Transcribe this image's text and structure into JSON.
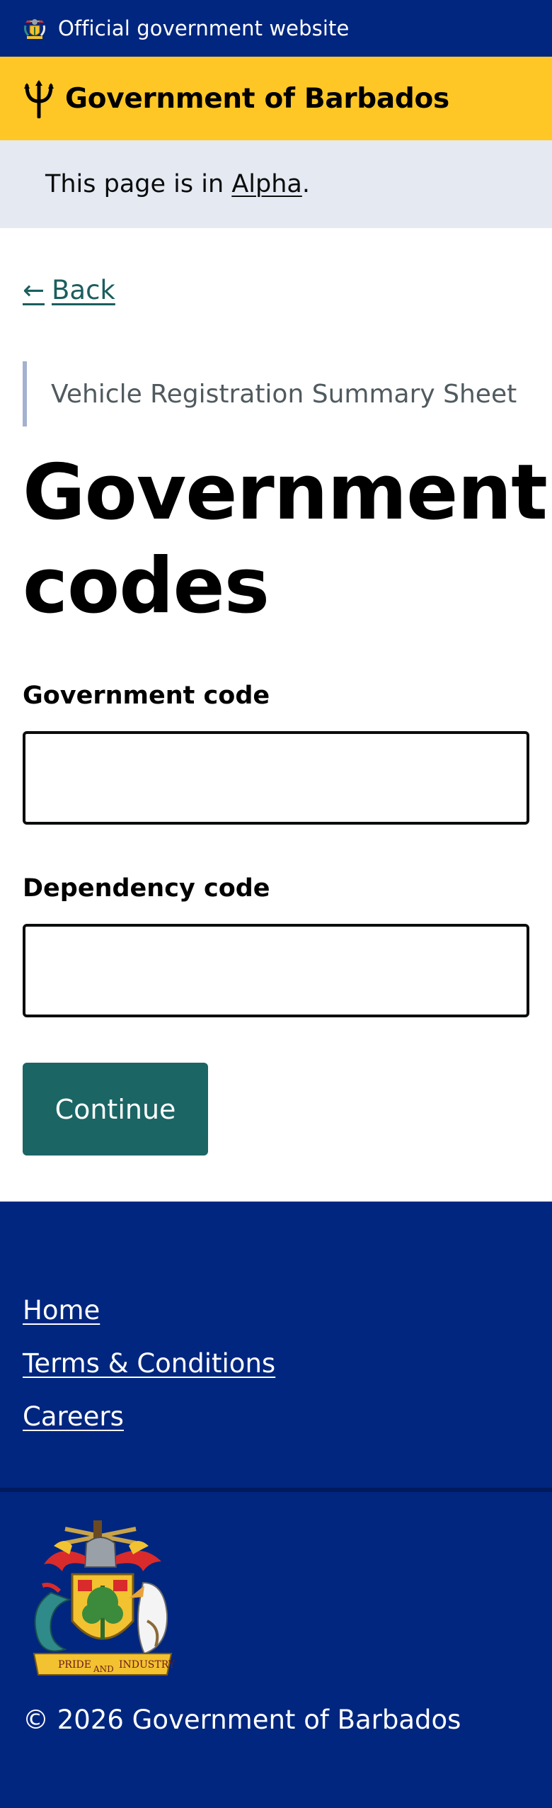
{
  "official_banner": {
    "text": "Official government website"
  },
  "header": {
    "brand": "Government of Barbados"
  },
  "phase_banner": {
    "prefix": "This page is in ",
    "link": "Alpha",
    "suffix": "."
  },
  "back_link": {
    "arrow": "←",
    "label": "Back"
  },
  "caption": "Vehicle Registration Summary Sheet",
  "heading": "Government codes",
  "form": {
    "government_code": {
      "label": "Government code",
      "value": "",
      "placeholder": ""
    },
    "dependency_code": {
      "label": "Dependency code",
      "value": "",
      "placeholder": ""
    },
    "continue_label": "Continue"
  },
  "footer": {
    "links": [
      {
        "label": "Home"
      },
      {
        "label": "Terms & Conditions"
      },
      {
        "label": "Careers"
      }
    ],
    "copyright": "© 2026 Government of Barbados",
    "motto": {
      "left": "PRIDE",
      "center": "AND",
      "right": "INDUSTRY"
    }
  },
  "colors": {
    "official_bar": "#00267f",
    "header_yellow": "#ffc726",
    "phase_bg": "#e5e9f2",
    "link_teal": "#1b5e5e",
    "button_teal": "#1b6565",
    "caption_border": "#a4b1cf"
  },
  "icons": {
    "official_crest": "coat-of-arms-icon",
    "trident": "trident-icon",
    "footer_crest": "coat-of-arms-icon"
  }
}
